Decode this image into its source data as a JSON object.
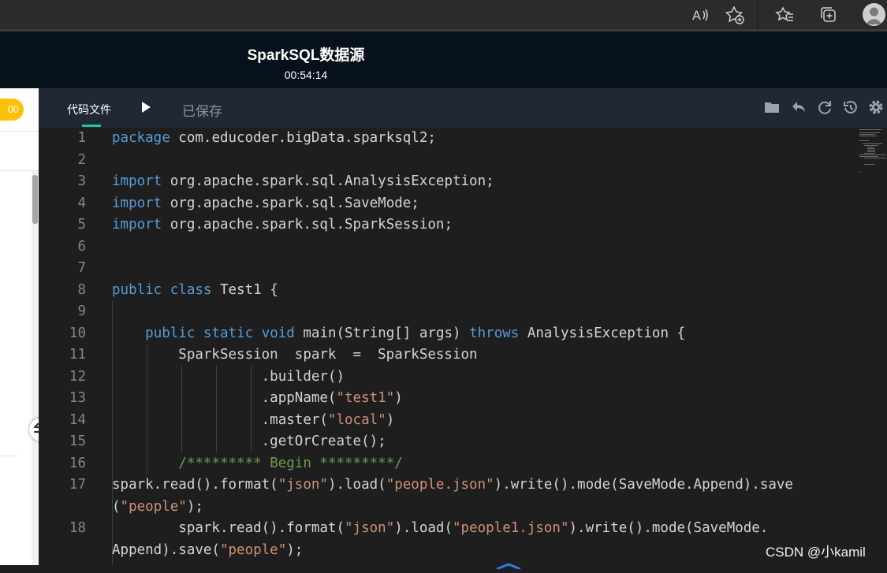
{
  "browser": {
    "icons": [
      "read-aloud-icon",
      "add-favorite-icon",
      "favorites-icon",
      "collections-icon",
      "profile-avatar-icon"
    ]
  },
  "header": {
    "title": "SparkSQL数据源",
    "timer": "00:54:14"
  },
  "left_panel": {
    "badge_text": "00"
  },
  "toolbar": {
    "tab_label": "代码文件",
    "save_status": "已保存",
    "icons": [
      "folder-icon",
      "undo-icon",
      "refresh-icon",
      "history-icon",
      "settings-icon"
    ]
  },
  "editor": {
    "line_numbers": [
      "1",
      "2",
      "3",
      "4",
      "5",
      "6",
      "7",
      "8",
      "9",
      "10",
      "11",
      "12",
      "13",
      "14",
      "15",
      "16",
      "17",
      "18"
    ],
    "lines": [
      [
        {
          "t": "package",
          "c": "kw"
        },
        {
          "t": " com.educoder.bigData.sparksql2;",
          "c": ""
        }
      ],
      [],
      [
        {
          "t": "import",
          "c": "kw"
        },
        {
          "t": " org.apache.spark.sql.AnalysisException;",
          "c": ""
        }
      ],
      [
        {
          "t": "import",
          "c": "kw"
        },
        {
          "t": " org.apache.spark.sql.SaveMode;",
          "c": ""
        }
      ],
      [
        {
          "t": "import",
          "c": "kw"
        },
        {
          "t": " org.apache.spark.sql.SparkSession;",
          "c": ""
        }
      ],
      [],
      [],
      [
        {
          "t": "public",
          "c": "kw"
        },
        {
          "t": " ",
          "c": ""
        },
        {
          "t": "class",
          "c": "kw"
        },
        {
          "t": " Test1 {",
          "c": ""
        }
      ],
      [],
      [
        {
          "t": "    ",
          "c": ""
        },
        {
          "t": "public",
          "c": "kw"
        },
        {
          "t": " ",
          "c": ""
        },
        {
          "t": "static",
          "c": "kw"
        },
        {
          "t": " ",
          "c": ""
        },
        {
          "t": "void",
          "c": "kw"
        },
        {
          "t": " main(String[] args) ",
          "c": ""
        },
        {
          "t": "throws",
          "c": "kw"
        },
        {
          "t": " AnalysisException {",
          "c": ""
        }
      ],
      [
        {
          "t": "        SparkSession  spark  =  SparkSession",
          "c": ""
        }
      ],
      [
        {
          "t": "                  .builder()",
          "c": ""
        }
      ],
      [
        {
          "t": "                  .appName(",
          "c": ""
        },
        {
          "t": "\"test1\"",
          "c": "str"
        },
        {
          "t": ")",
          "c": ""
        }
      ],
      [
        {
          "t": "                  .master(",
          "c": ""
        },
        {
          "t": "\"local\"",
          "c": "str"
        },
        {
          "t": ")",
          "c": ""
        }
      ],
      [
        {
          "t": "                  .getOrCreate();",
          "c": ""
        }
      ],
      [
        {
          "t": "        ",
          "c": ""
        },
        {
          "t": "/********* Begin *********/",
          "c": "cmt"
        }
      ],
      [
        {
          "t": "spark.read().format(",
          "c": ""
        },
        {
          "t": "\"json\"",
          "c": "str"
        },
        {
          "t": ").load(",
          "c": ""
        },
        {
          "t": "\"people.json\"",
          "c": "str"
        },
        {
          "t": ").write().mode(SaveMode.Append).save",
          "c": ""
        }
      ],
      [
        {
          "t": "(",
          "c": ""
        },
        {
          "t": "\"people\"",
          "c": "str"
        },
        {
          "t": ");",
          "c": ""
        }
      ],
      [
        {
          "t": "        spark.read().format(",
          "c": ""
        },
        {
          "t": "\"json\"",
          "c": "str"
        },
        {
          "t": ").load(",
          "c": ""
        },
        {
          "t": "\"people1.json\"",
          "c": "str"
        },
        {
          "t": ").write().mode(SaveMode.",
          "c": ""
        }
      ],
      [
        {
          "t": "Append).save(",
          "c": ""
        },
        {
          "t": "\"people\"",
          "c": "str"
        },
        {
          "t": ");",
          "c": ""
        }
      ]
    ]
  },
  "watermark": "CSDN @小kamil"
}
